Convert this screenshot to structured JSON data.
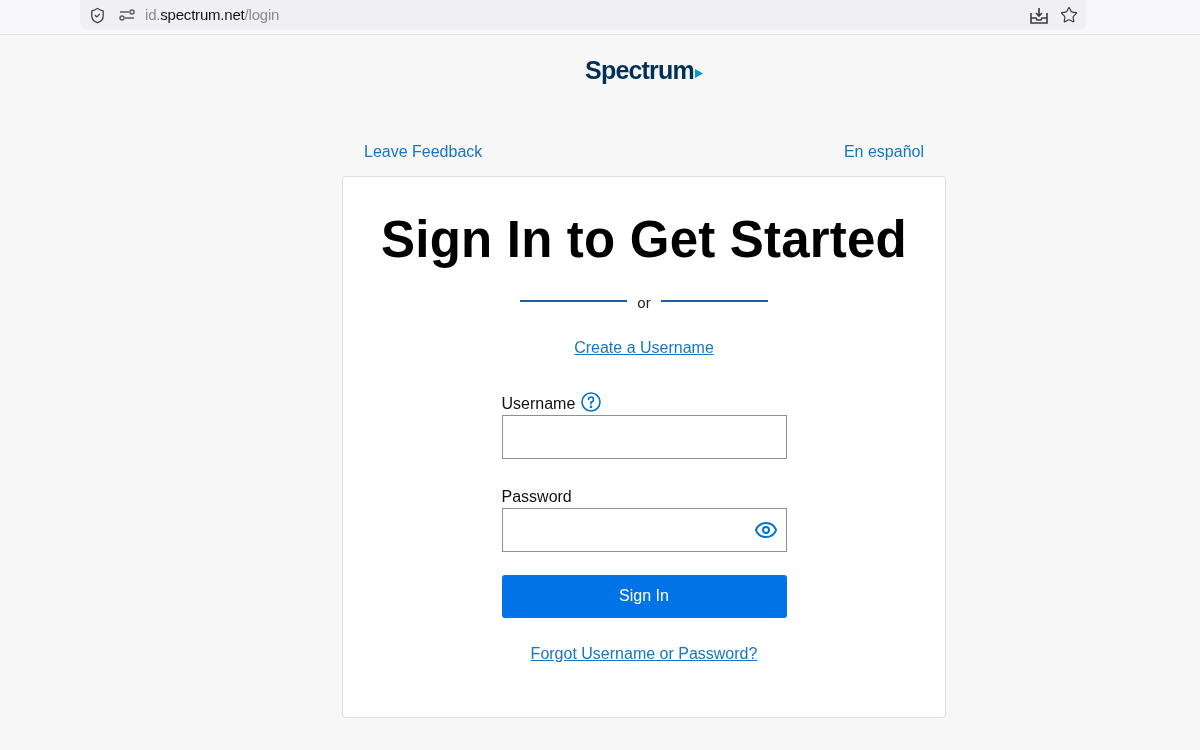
{
  "browser": {
    "address_bar": {
      "subdomain": "id.",
      "domain": "spectrum.net",
      "path": "/login"
    }
  },
  "header": {
    "logo": "Spectrum"
  },
  "top_links": [
    "Leave Feedback",
    "En español"
  ],
  "card": {
    "title": "Sign In to Get Started",
    "divider_text": "or",
    "create_link": "Create a Username",
    "fields": [
      {
        "label": "Username",
        "kind": "text",
        "help": true
      },
      {
        "label": "Password",
        "kind": "password",
        "help": false
      }
    ],
    "submit": "Sign In",
    "forgot_link": "Forgot Username or Password?"
  }
}
